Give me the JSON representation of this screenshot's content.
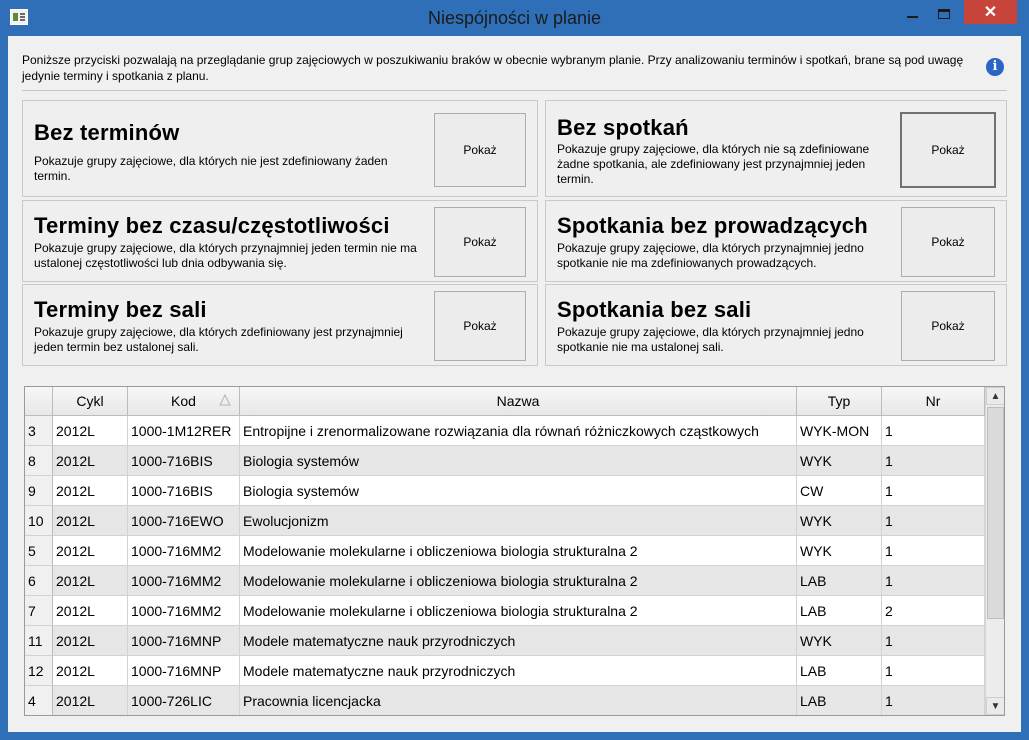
{
  "window": {
    "title": "Niespójności w planie",
    "close_label": "✕"
  },
  "info": {
    "text": "Poniższe przyciski pozwalają na przeglądanie grup zajęciowych w poszukiwaniu braków w obecnie wybranym planie. Przy analizowaniu terminów i spotkań, brane są pod uwagę jedynie terminy i spotkania z planu.",
    "icon_glyph": "i"
  },
  "groups": [
    {
      "title": "Bez terminów",
      "description": "Pokazuje grupy zajęciowe, dla których nie jest zdefiniowany żaden termin.",
      "button": "Pokaż"
    },
    {
      "title": "Bez spotkań",
      "description": "Pokazuje grupy zajęciowe, dla których nie są zdefiniowane żadne spotkania, ale zdefiniowany jest przynajmniej jeden termin.",
      "button": "Pokaż"
    },
    {
      "title": "Terminy bez czasu/częstotliwości",
      "description": "Pokazuje grupy zajęciowe, dla których przynajmniej jeden termin nie ma ustalonej częstotliwości lub dnia odbywania się.",
      "button": "Pokaż"
    },
    {
      "title": "Spotkania bez prowadzących",
      "description": "Pokazuje grupy zajęciowe, dla których przynajmniej jedno spotkanie nie ma zdefiniowanych prowadzących.",
      "button": "Pokaż"
    },
    {
      "title": "Terminy bez sali",
      "description": "Pokazuje grupy zajęciowe, dla których zdefiniowany jest przynajmniej jeden termin bez ustalonej sali.",
      "button": "Pokaż"
    },
    {
      "title": "Spotkania bez sali",
      "description": "Pokazuje grupy zajęciowe, dla których przynajmniej jedno spotkanie nie ma ustalonej sali.",
      "button": "Pokaż"
    }
  ],
  "table": {
    "columns": [
      "",
      "Cykl",
      "Kod",
      "Nazwa",
      "Typ",
      "Nr"
    ],
    "sort_column": "Kod",
    "rows": [
      {
        "id": "3",
        "cykl": "2012L",
        "kod": "1000-1M12RER",
        "nazwa": "Entropijne i zrenormalizowane rozwiązania dla równań różniczkowych cząstkowych",
        "typ": "WYK-MON",
        "nr": "1"
      },
      {
        "id": "8",
        "cykl": "2012L",
        "kod": "1000-716BIS",
        "nazwa": "Biologia systemów",
        "typ": "WYK",
        "nr": "1"
      },
      {
        "id": "9",
        "cykl": "2012L",
        "kod": "1000-716BIS",
        "nazwa": "Biologia systemów",
        "typ": "CW",
        "nr": "1"
      },
      {
        "id": "10",
        "cykl": "2012L",
        "kod": "1000-716EWO",
        "nazwa": "Ewolucjonizm",
        "typ": "WYK",
        "nr": "1"
      },
      {
        "id": "5",
        "cykl": "2012L",
        "kod": "1000-716MM2",
        "nazwa": "Modelowanie molekularne i obliczeniowa biologia strukturalna 2",
        "typ": "WYK",
        "nr": "1"
      },
      {
        "id": "6",
        "cykl": "2012L",
        "kod": "1000-716MM2",
        "nazwa": "Modelowanie molekularne i obliczeniowa biologia strukturalna 2",
        "typ": "LAB",
        "nr": "1"
      },
      {
        "id": "7",
        "cykl": "2012L",
        "kod": "1000-716MM2",
        "nazwa": "Modelowanie molekularne i obliczeniowa biologia strukturalna 2",
        "typ": "LAB",
        "nr": "2"
      },
      {
        "id": "11",
        "cykl": "2012L",
        "kod": "1000-716MNP",
        "nazwa": "Modele matematyczne nauk przyrodniczych",
        "typ": "WYK",
        "nr": "1"
      },
      {
        "id": "12",
        "cykl": "2012L",
        "kod": "1000-716MNP",
        "nazwa": "Modele matematyczne nauk przyrodniczych",
        "typ": "LAB",
        "nr": "1"
      },
      {
        "id": "4",
        "cykl": "2012L",
        "kod": "1000-726LIC",
        "nazwa": "Pracownia licencjacka",
        "typ": "LAB",
        "nr": "1"
      }
    ]
  },
  "scrollbar": {
    "up_glyph": "▲",
    "down_glyph": "▼"
  },
  "colors": {
    "titlebar": "#2f6fb7",
    "close_button": "#c7443a",
    "info_icon": "#2a64c5",
    "row_alt": "#e6e6e6"
  }
}
